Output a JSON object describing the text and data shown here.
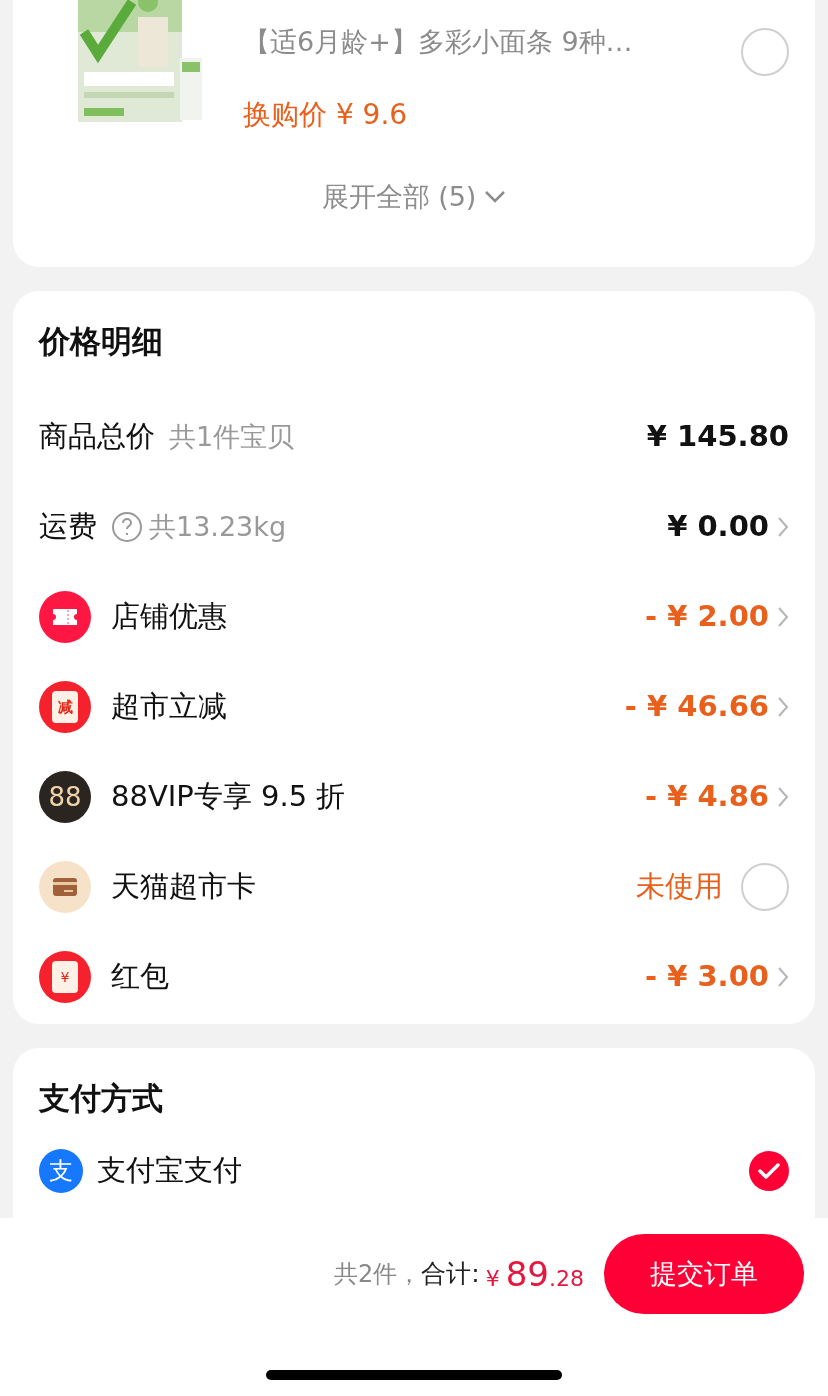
{
  "exchange_item": {
    "title": "【适6月龄+】多彩小面条 9种…",
    "price": "换购价 ¥ 9.6",
    "selected": false
  },
  "expand": {
    "label": "展开全部 (5)"
  },
  "price_detail": {
    "title": "价格明细",
    "rows": [
      {
        "kind": "total",
        "label": "商品总价",
        "note": "共1件宝贝",
        "value": "¥ 145.80",
        "chevron": false
      },
      {
        "kind": "shipping",
        "label": "运费",
        "note": "共13.23kg",
        "value": "¥ 0.00",
        "chevron": true
      },
      {
        "kind": "coupon",
        "label": "店铺优惠",
        "value": "- ¥ 2.00",
        "chevron": true
      },
      {
        "kind": "reduce",
        "icon_text": "减",
        "label": "超市立减",
        "value": "- ¥ 46.66",
        "chevron": true
      },
      {
        "kind": "vip",
        "icon_text": "88",
        "label": "88VIP专享 9.5 折",
        "value": "- ¥ 4.86",
        "chevron": true
      },
      {
        "kind": "card",
        "label": "天猫超市卡",
        "value": "未使用",
        "checked": false
      },
      {
        "kind": "packet",
        "icon_text": "¥",
        "label": "红包",
        "value": "- ¥ 3.00",
        "chevron": true
      }
    ]
  },
  "payment": {
    "title": "支付方式",
    "methods": [
      {
        "label": "支付宝支付",
        "icon_text": "支",
        "selected": true
      }
    ]
  },
  "footer": {
    "count": "共2件，",
    "label": "合计:",
    "currency": "¥",
    "integer": "89",
    "decimal": ".28",
    "submit": "提交订单"
  }
}
